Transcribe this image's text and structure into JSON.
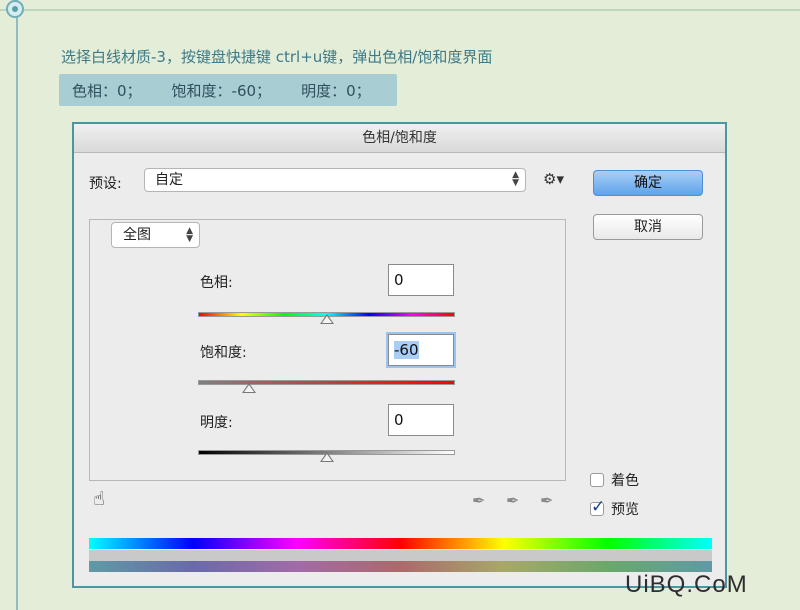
{
  "tutorial": {
    "instruction": "选择白线材质-3，按键盘快捷键 ctrl+u键，弹出色相/饱和度界面",
    "params": [
      "色相：0；",
      "饱和度：-60；",
      "明度：0；"
    ]
  },
  "dialog": {
    "title": "色相/饱和度",
    "preset_label": "预设:",
    "preset_value": "自定",
    "gear_icon": "gear-icon",
    "ok_label": "确定",
    "cancel_label": "取消",
    "channel_value": "全图",
    "hue": {
      "label": "色相:",
      "value": "0",
      "range": [
        -180,
        180
      ]
    },
    "saturation": {
      "label": "饱和度:",
      "value": "-60",
      "range": [
        -100,
        100
      ]
    },
    "lightness": {
      "label": "明度:",
      "value": "0",
      "range": [
        -100,
        100
      ]
    },
    "colorize": {
      "label": "着色",
      "checked": false
    },
    "preview": {
      "label": "预览",
      "checked": true
    }
  },
  "watermark": "UiBQ.CoM"
}
